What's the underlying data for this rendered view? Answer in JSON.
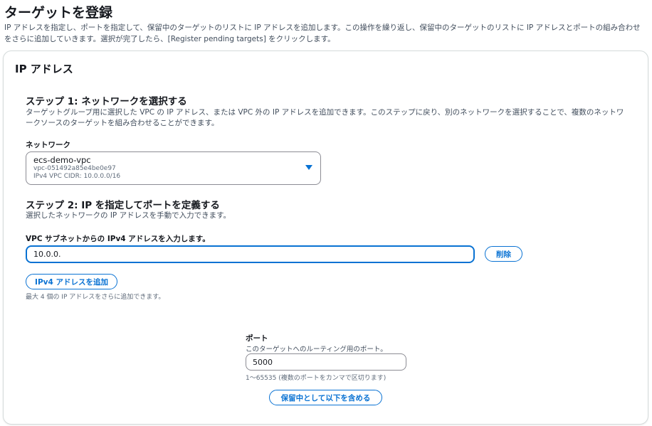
{
  "page": {
    "title": "ターゲットを登録",
    "description": "IP アドレスを指定し、ポートを指定して、保留中のターゲットのリストに IP アドレスを追加します。この操作を繰り返し、保留中のターゲットのリストに IP アドレスとポートの組み合わせをさらに追加していきます。選択が完了したら、[Register pending targets] をクリックします。"
  },
  "panel": {
    "title": "IP アドレス",
    "step1": {
      "title": "ステップ 1: ネットワークを選択する",
      "description": "ターゲットグループ用に選択した VPC の IP アドレス、または VPC 外の IP アドレスを追加できます。このステップに戻り、別のネットワークを選択することで、複数のネットワークソースのターゲットを組み合わせることができます。",
      "network_label": "ネットワーク",
      "network_selected": {
        "name": "ecs-demo-vpc",
        "id": "vpc-051492a85e4be0e97",
        "cidr": "IPv4 VPC CIDR: 10.0.0.0/16"
      }
    },
    "step2": {
      "title": "ステップ 2: IP を指定してポートを定義する",
      "description": "選択したネットワークの IP アドレスを手動で入力できます。",
      "ip_label": "VPC サブネットからの IPv4 アドレスを入力します。",
      "ip_value": "10.0.0.",
      "remove_label": "削除",
      "add_ip_label": "IPv4 アドレスを追加",
      "add_ip_hint": "最大 4 個の IP アドレスをさらに追加できます。",
      "port_label": "ポート",
      "port_desc": "このターゲットへのルーティング用のポート。",
      "port_value": "5000",
      "port_hint": "1〜65535 (複数のポートをカンマで区切ります)",
      "include_pending_label": "保留中として以下を含める"
    }
  },
  "colors": {
    "accent": "#0972d3",
    "text": "#16191f",
    "muted": "#414d5c",
    "border": "#8c8c94"
  }
}
